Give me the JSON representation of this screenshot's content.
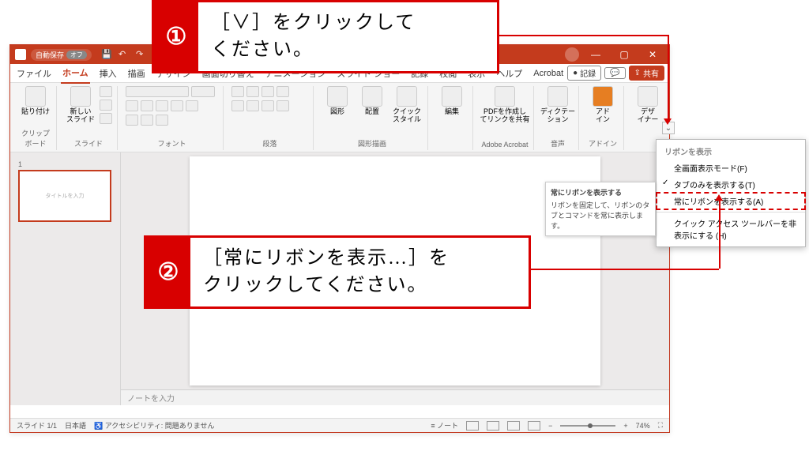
{
  "titlebar": {
    "autosave_label": "自動保存",
    "autosave_state": "オフ"
  },
  "tabs": {
    "file": "ファイル",
    "home": "ホーム",
    "insert": "挿入",
    "draw": "描画",
    "design": "デザイン",
    "transitions": "画面切り替え",
    "animations": "アニメーション",
    "slideshow": "スライド ショー",
    "record_tab": "記録",
    "review": "校閲",
    "view": "表示",
    "help": "ヘルプ",
    "acrobat": "Acrobat",
    "record_btn": "記録",
    "share_btn": "共有"
  },
  "ribbon": {
    "clipboard": {
      "paste": "貼り付け",
      "label": "クリップボード"
    },
    "slides": {
      "new_slide": "新しい\nスライド",
      "label": "スライド"
    },
    "font": {
      "label": "フォント"
    },
    "paragraph": {
      "label": "段落"
    },
    "drawing": {
      "shapes": "図形",
      "arrange": "配置",
      "quick": "クイック\nスタイル",
      "label": "図形描画"
    },
    "editing": {
      "edit": "編集"
    },
    "acrobat": {
      "pdf": "PDFを作成し\nてリンクを共有",
      "label": "Adobe Acrobat"
    },
    "voice": {
      "dictate": "ディクテー\nション",
      "label": "音声"
    },
    "addin": {
      "addin": "アド\nイン",
      "label": "アドイン"
    },
    "designer": {
      "designer": "デザ\nイナー"
    }
  },
  "slide": {
    "title_placeholder": "タイトルを入力",
    "notes_placeholder": "ノートを入力"
  },
  "statusbar": {
    "slide_count": "スライド 1/1",
    "language": "日本語",
    "accessibility": "アクセシビリティ: 問題ありません",
    "notes_btn": "ノート",
    "zoom": "74%"
  },
  "chevron": "⌄",
  "dropdown": {
    "section": "リボンを表示",
    "full_screen": "全画面表示モード(F)",
    "tabs_only": "タブのみを表示する(T)",
    "always_show": "常にリボンを表示する(A)",
    "hide_qat": "クイック アクセス ツールバーを非表示にする (H)"
  },
  "tooltip": {
    "title": "常にリボンを表示する",
    "body": "リボンを固定して、リボンのタブとコマンドを常に表示します。"
  },
  "callouts": {
    "n1": "①",
    "t1": "［∨］をクリックして\nください。",
    "n2": "②",
    "t2": "［常にリボンを表示…］を\nクリックしてください。"
  }
}
